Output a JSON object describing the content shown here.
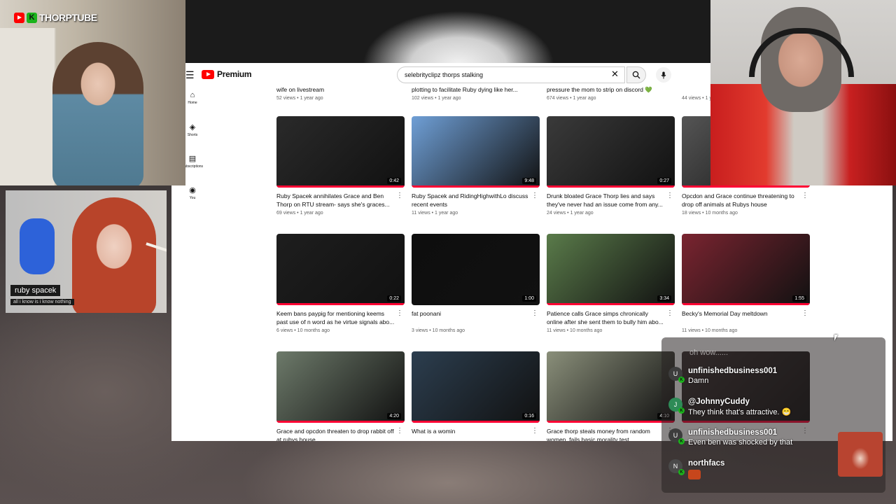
{
  "brand": {
    "name": "THORPTUBE"
  },
  "youtube": {
    "logo_text": "Premium",
    "search_value": "selebrityclipz thorps stalking",
    "side_items": [
      {
        "icon": "home-icon",
        "label": "Home"
      },
      {
        "icon": "shorts-icon",
        "label": "Shorts"
      },
      {
        "icon": "subscriptions-icon",
        "label": "Subscriptions"
      },
      {
        "icon": "you-icon",
        "label": "You"
      }
    ],
    "partial_row": [
      {
        "title": "wife on livestream",
        "info": "52 views • 1 year ago"
      },
      {
        "title": "plotting to facilitate Ruby dying like her...",
        "info": "102 views • 1 year ago"
      },
      {
        "title": "pressure the mom to strip on discord 💚",
        "info": "674 views • 1 year ago"
      },
      {
        "title": "",
        "info": "44 views • 1 year ago"
      }
    ],
    "rows": [
      [
        {
          "title": "Ruby Spacek annihilates Grace and Ben Thorp on RTU stream- says she's graces...",
          "info": "69 views • 1 year ago",
          "duration": "0:42",
          "thumb": "#2a2a2a",
          "progress": 1.0
        },
        {
          "title": "Ruby Spacek and RidingHighwithLo discuss recent events",
          "info": "11 views • 1 year ago",
          "duration": "9:48",
          "thumb": "#6f9fd6",
          "progress": 1.0
        },
        {
          "title": "Drunk bloated Grace Thorp lies and says they've never had an issue come from any...",
          "info": "24 views • 1 year ago",
          "duration": "0:27",
          "thumb": "#3a3a3a",
          "progress": 1.0
        },
        {
          "title": "Opcdon and Grace continue threatening to drop off animals at Rubys house",
          "info": "18 views • 10 months ago",
          "duration": "",
          "thumb": "#555555",
          "progress": 1.0
        }
      ],
      [
        {
          "title": "Keem bans paypig for mentioning keems past use of n word as he virtue signals abo...",
          "info": "6 views • 10 months ago",
          "duration": "0:22",
          "thumb": "#1e1e1e",
          "progress": 1.0
        },
        {
          "title": "fat poonani",
          "info": "3 views • 10 months ago",
          "duration": "1:00",
          "thumb": "#0e0e0e",
          "progress": 0
        },
        {
          "title": "Patience calls Grace simps chronically online after she sent them to bully him abo...",
          "info": "11 views • 10 months ago",
          "duration": "3:34",
          "thumb": "#5a7b4a",
          "progress": 1.0
        },
        {
          "title": "Becky's Memorial Day meltdown",
          "info": "11 views • 10 months ago",
          "duration": "1:55",
          "thumb": "#7a2430",
          "progress": 1.0
        }
      ],
      [
        {
          "title": "Grace and opcdon threaten to drop rabbit off at rubys house",
          "info": "",
          "duration": "4:20",
          "thumb": "#6d7a6a",
          "progress": 1.0
        },
        {
          "title": "What is a womin",
          "info": "",
          "duration": "0:16",
          "thumb": "#2c3e4f",
          "progress": 1.0
        },
        {
          "title": "Grace thorp steals money from random women, fails basic morality test",
          "info": "",
          "duration": "4:10",
          "thumb": "#8a8f7a",
          "progress": 1.0
        },
        {
          "title": "",
          "info": "",
          "duration": "",
          "thumb": "#3a3030",
          "progress": 1.0
        }
      ]
    ]
  },
  "cams": {
    "guest_name": "ruby spacek",
    "guest_caption": "all i know is i know nothing"
  },
  "chat": {
    "faded": "oh wow......",
    "messages": [
      {
        "user": "unfinishedbusiness001",
        "text": "Damn",
        "avatar_letter": "U",
        "avatar_color": "#3d3d3d"
      },
      {
        "user": "@JohnnyCuddy",
        "text": "They think that's attractive. 😁",
        "avatar_letter": "J",
        "avatar_color": "#2e8b57"
      },
      {
        "user": "unfinishedbusiness001",
        "text": "Even ben was shocked by that",
        "avatar_letter": "U",
        "avatar_color": "#3d3d3d"
      },
      {
        "user": "northfacs",
        "text": "",
        "avatar_letter": "N",
        "avatar_color": "#4a4a4a"
      }
    ]
  },
  "colors": {
    "yt_red": "#ff0000",
    "kick_green": "#1bb31b",
    "progress_red": "#ff0033"
  }
}
